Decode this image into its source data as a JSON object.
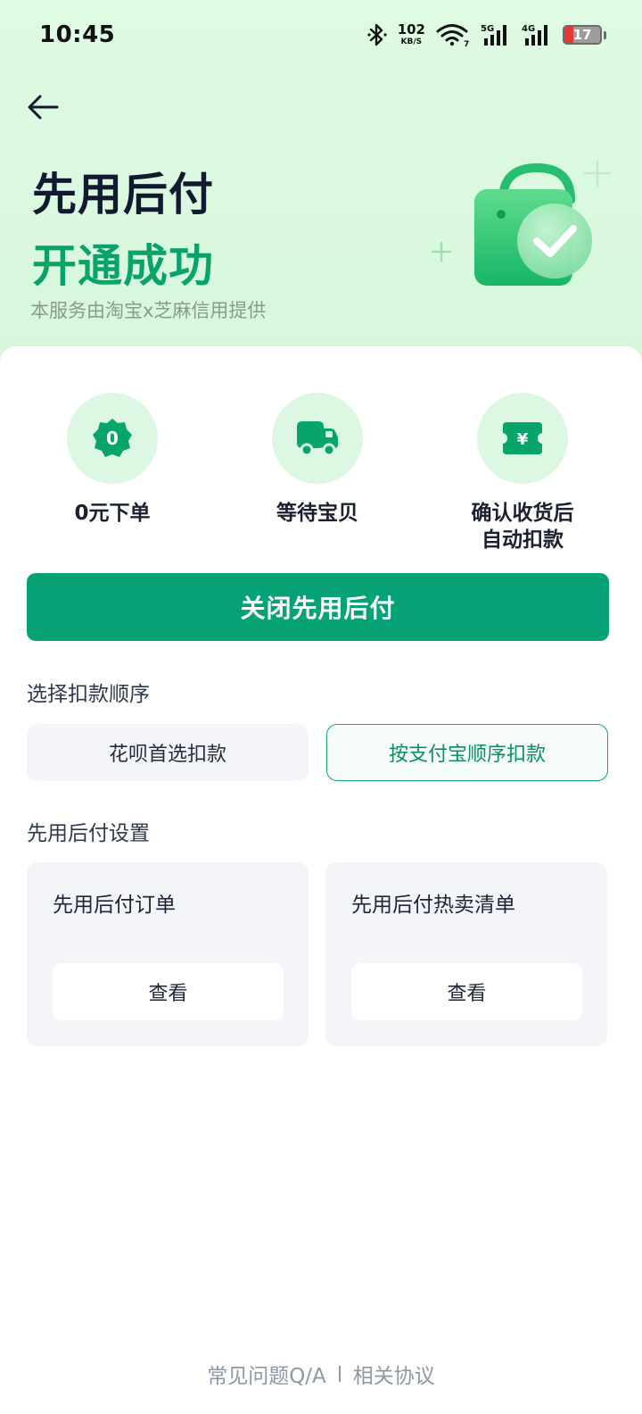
{
  "status_bar": {
    "time": "10:45",
    "net_speed_value": "102",
    "net_speed_unit": "KB/S",
    "wifi_badge": "7",
    "signal1_label": "5G",
    "signal2_label": "4G",
    "battery_percent": "17"
  },
  "hero": {
    "title": "先用后付",
    "subtitle": "开通成功",
    "note": "本服务由淘宝x芝麻信用提供"
  },
  "steps": [
    {
      "label": "0元下单",
      "icon": "zero-badge-icon",
      "badge_text": "0"
    },
    {
      "label": "等待宝贝",
      "icon": "delivery-truck-icon"
    },
    {
      "label": "确认收货后\n自动扣款",
      "icon": "yuan-ticket-icon",
      "badge_text": "¥"
    }
  ],
  "primary_button": "关闭先用后付",
  "deduction": {
    "label": "选择扣款顺序",
    "options": [
      {
        "label": "花呗首选扣款",
        "selected": false
      },
      {
        "label": "按支付宝顺序扣款",
        "selected": true
      }
    ]
  },
  "settings": {
    "label": "先用后付设置",
    "cards": [
      {
        "title": "先用后付订单",
        "button": "查看"
      },
      {
        "title": "先用后付热卖清单",
        "button": "查看"
      }
    ]
  },
  "footer": {
    "faq": "常见问题Q/A",
    "agreements": "相关协议"
  },
  "colors": {
    "brand_green": "#06a174",
    "hero_background": "#dffbe3",
    "step_circle": "#dcf8e3",
    "battery_low": "#e53935"
  }
}
